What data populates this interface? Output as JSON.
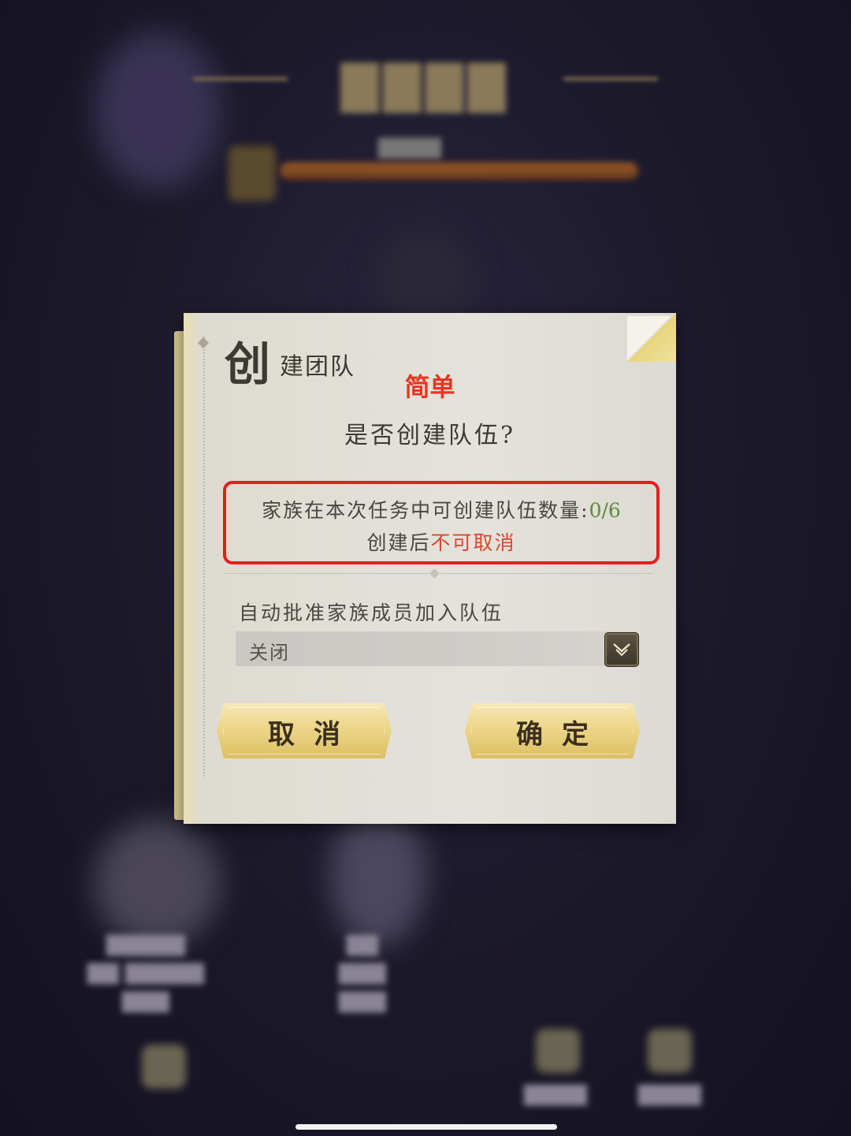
{
  "dialog": {
    "title_first_char": "创",
    "title_rest": "建团队",
    "annotation": "简单",
    "question": "是否创建队伍?",
    "info": {
      "line1_prefix": "家族在本次任务中可创建队伍数量:",
      "count": "0/6",
      "line2_prefix": "创建后",
      "line2_warning": "不可取消"
    },
    "auto_approve": {
      "label": "自动批准家族成员加入队伍",
      "selected_value": "关闭"
    },
    "buttons": {
      "cancel_label": "取消",
      "confirm_label": "确定"
    }
  },
  "colors": {
    "annotation_red": "#e8351f",
    "highlight_box": "#e61e1e",
    "count_green": "#5f8a3a",
    "warning_red": "#d9482a",
    "button_gold": "#ecd689"
  },
  "icons": {
    "select_arrow": "chevron-down-icon"
  }
}
